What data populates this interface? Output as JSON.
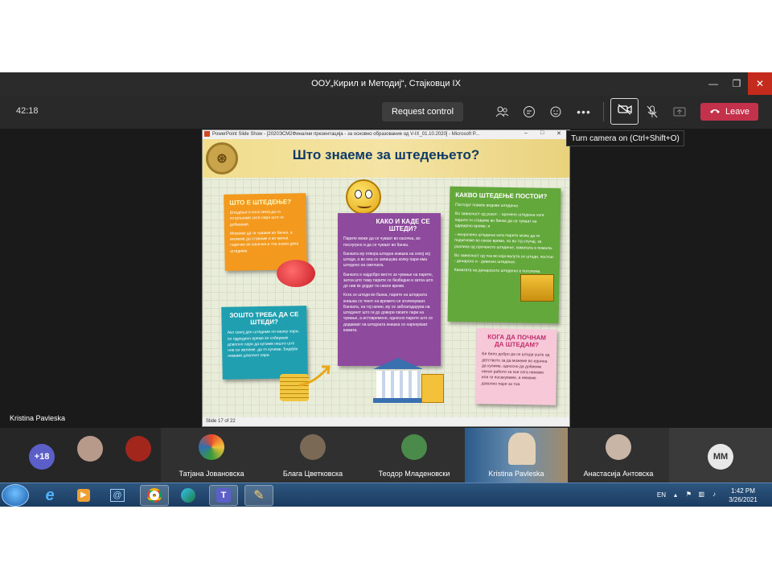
{
  "window": {
    "title": "ООУ„Кирил и Методиј“, Стајковци IX",
    "minimize": "—",
    "maximize": "❐",
    "close": "✕"
  },
  "toolbar": {
    "timer": "42:18",
    "request_control": "Request control",
    "leave": "Leave",
    "tooltip": "Turn camera on (Ctrl+Shift+O)"
  },
  "ppt": {
    "titlebar": "PowerPoint Slide Show - [2020ЭСМ2Финални презентација - за основно образование од V-IX_01.10.2020] - Microsoft P...",
    "status": "Slide 17 of 22",
    "slide_title": "Што знаеме за штедењето?",
    "notes": [
      {
        "title": "ШТО Е ШТЕДЕЊЕ?",
        "lines": [
          "Штедење е кога некој да ги потрошиме сите пари што ги добиваме.",
          "Можеме да ги чуваме во банка, а можеме да ставиме и во мечка парички во касичка и тоа значи дека штедиме."
        ]
      },
      {
        "title": "КАКО И КАДЕ СЕ ШТЕДИ?",
        "lines": [
          "Парите може да се чуваат во касичка, во послугрно и да се чуваат во банка.",
          "Банката му отвора штедна книшка на секој кој штеди, а во неа се запишува колку пари има штедено на сметката.",
          "Банката е најдобро место за чување на парите, затоа што таму парите се безбедни и затоа што до нив ќе дојдат по некое време.",
          "Кога се штеди во банка, парите на штедната книшка со текот на времето се зголемуваат. Банката, на тој начин, му се заблагодарува на штедачот што ги до довери своите пари на чување, а истовремено, однесно парите што се додаваат на штедната книшка се нарекуваат камата."
        ]
      },
      {
        "title": "КАКВО ШТЕДЕЊЕ ПОСТОИ?",
        "lines": [
          "Постојат повеќе видови штедење.",
          "Во зависност од рокот: - орочено штедење кога парите ги ставаме во банка да се чуваат на одредено време; и",
          "- неорочено штедење кога парите може да ги подигнеме во секое време, но во тој случај, за разлика од ороченото штедење, каматата е помала.",
          "Во зависност од тоа во која валута се штеди, постои: - денарско и - девизно штедење.",
          "Каматата на денарското штедење е поголема."
        ]
      },
      {
        "title": "ЗОШТО ТРЕБА ДА СЕ ШТЕДИ?",
        "lines": [
          "Ако секој ден штедиме по малку пари, по одредено време ќе собереме доволно пари да купиме нешто што ние си желеме, да го купиме. Бидејќи немаме доволно пари."
        ]
      },
      {
        "title": "КОГА ДА ПОЧНАМ ДА ШТЕДАМ?",
        "lines": [
          "Би било добро да се штеди уште од детството за да можеме во иднина да купиме, односно да добиеме некои работи за кои сега немаме или ги посакуваме, а немаме доволно пари за тоа."
        ]
      }
    ]
  },
  "presenter": "Kristina Pavleska",
  "participants": [
    {
      "name": "",
      "initials": "+18",
      "color": "#5b5fc7"
    },
    {
      "name": "",
      "initials": "",
      "color": "#b89a8a"
    },
    {
      "name": "",
      "initials": "",
      "color": "#a3261c"
    },
    {
      "name": "Татјана Јовановска",
      "initials": "",
      "color": "#e84a2a"
    },
    {
      "name": "Блага Цветковска",
      "initials": "",
      "color": "#7a6a55"
    },
    {
      "name": "Теодор Младеновски",
      "initials": "",
      "color": "#4a8a4a"
    },
    {
      "name": "Kristina Pavleska",
      "initials": "",
      "color": "#2f6fb0"
    },
    {
      "name": "Анастасија Антовска",
      "initials": "",
      "color": "#c9b5a5"
    },
    {
      "name": "",
      "initials": "ММ",
      "color": "#e8e8e8"
    }
  ],
  "taskbar": {
    "lang": "EN",
    "time": "1:42 PM",
    "date": "3/26/2021"
  }
}
